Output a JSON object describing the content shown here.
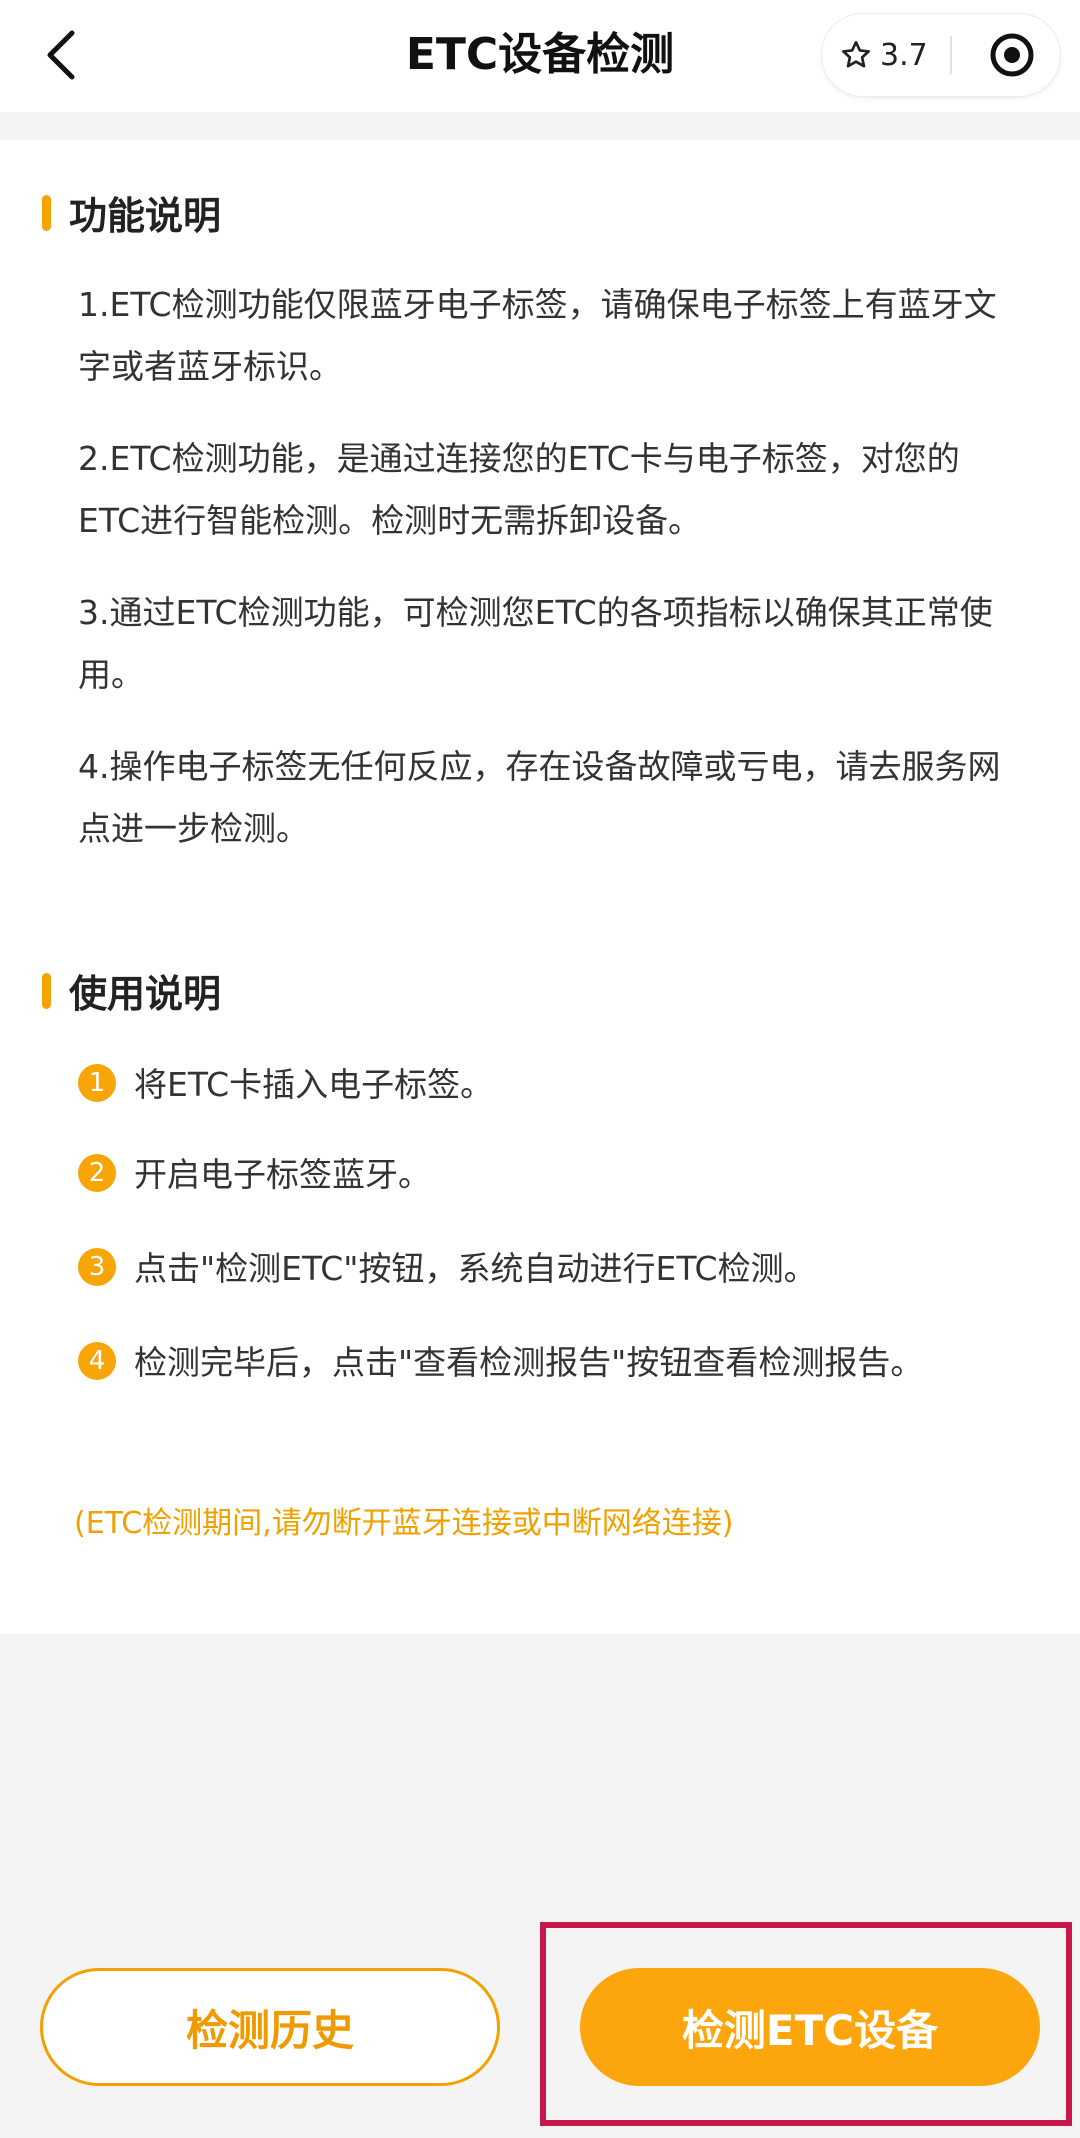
{
  "header": {
    "title": "ETC设备检测",
    "rating": "3.7",
    "back_icon": "chevron-left-icon",
    "star_icon": "star-outline-icon",
    "record_icon": "target-circle-icon"
  },
  "function_section": {
    "title": "功能说明",
    "paragraphs": [
      "1.ETC检测功能仅限蓝牙电子标签，请确保电子标签上有蓝牙文字或者蓝牙标识。",
      "2.ETC检测功能，是通过连接您的ETC卡与电子标签，对您的ETC进行智能检测。检测时无需拆卸设备。",
      "3.通过ETC检测功能，可检测您ETC的各项指标以确保其正常使用。",
      "4.操作电子标签无任何反应，存在设备故障或亏电，请去服务网点进一步检测。"
    ]
  },
  "usage_section": {
    "title": "使用说明",
    "steps": [
      {
        "num": "1",
        "text": "将ETC卡插入电子标签。"
      },
      {
        "num": "2",
        "text": "开启电子标签蓝牙。"
      },
      {
        "num": "3",
        "text": "点击\"检测ETC\"按钮，系统自动进行ETC检测。"
      },
      {
        "num": "4",
        "text": "检测完毕后，点击\"查看检测报告\"按钮查看检测报告。"
      }
    ],
    "note": "(ETC检测期间,请勿断开蓝牙连接或中断网络连接)"
  },
  "buttons": {
    "history_label": "检测历史",
    "detect_label": "检测ETC设备"
  },
  "colors": {
    "accent": "#f5a300",
    "highlight": "#c8174a"
  }
}
